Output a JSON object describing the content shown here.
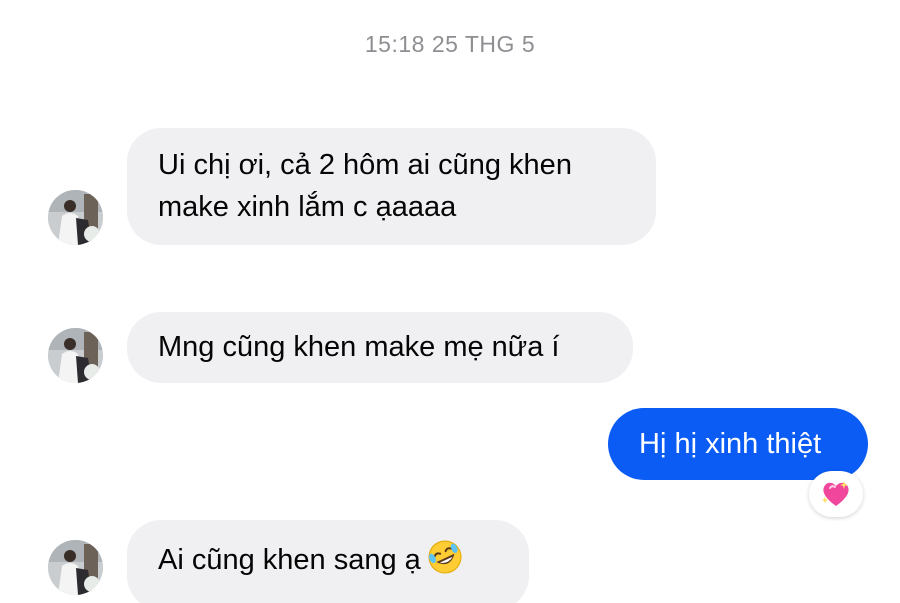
{
  "thread": {
    "timestamp": "15:18 25 THG 5"
  },
  "messages": [
    {
      "direction": "incoming",
      "lines": [
        "Ui chị ơi, cả 2 hôm ai cũng khen",
        "make xinh lắm c ạaaaa"
      ]
    },
    {
      "direction": "incoming",
      "lines": [
        "Mng cũng khen make mẹ nữa í"
      ]
    },
    {
      "direction": "outgoing",
      "lines": [
        "Hị hị xinh thiệt"
      ],
      "reaction": "sparkling-heart-icon"
    },
    {
      "direction": "incoming",
      "lines": [
        "Ai cũng khen sang ạ"
      ],
      "trailing_emoji": "rolling-on-floor-laughing-icon"
    }
  ],
  "colors": {
    "outgoing_bubble": "#0a5cf5",
    "incoming_bubble": "#f0f0f2",
    "timestamp_text": "#8e8e93"
  }
}
